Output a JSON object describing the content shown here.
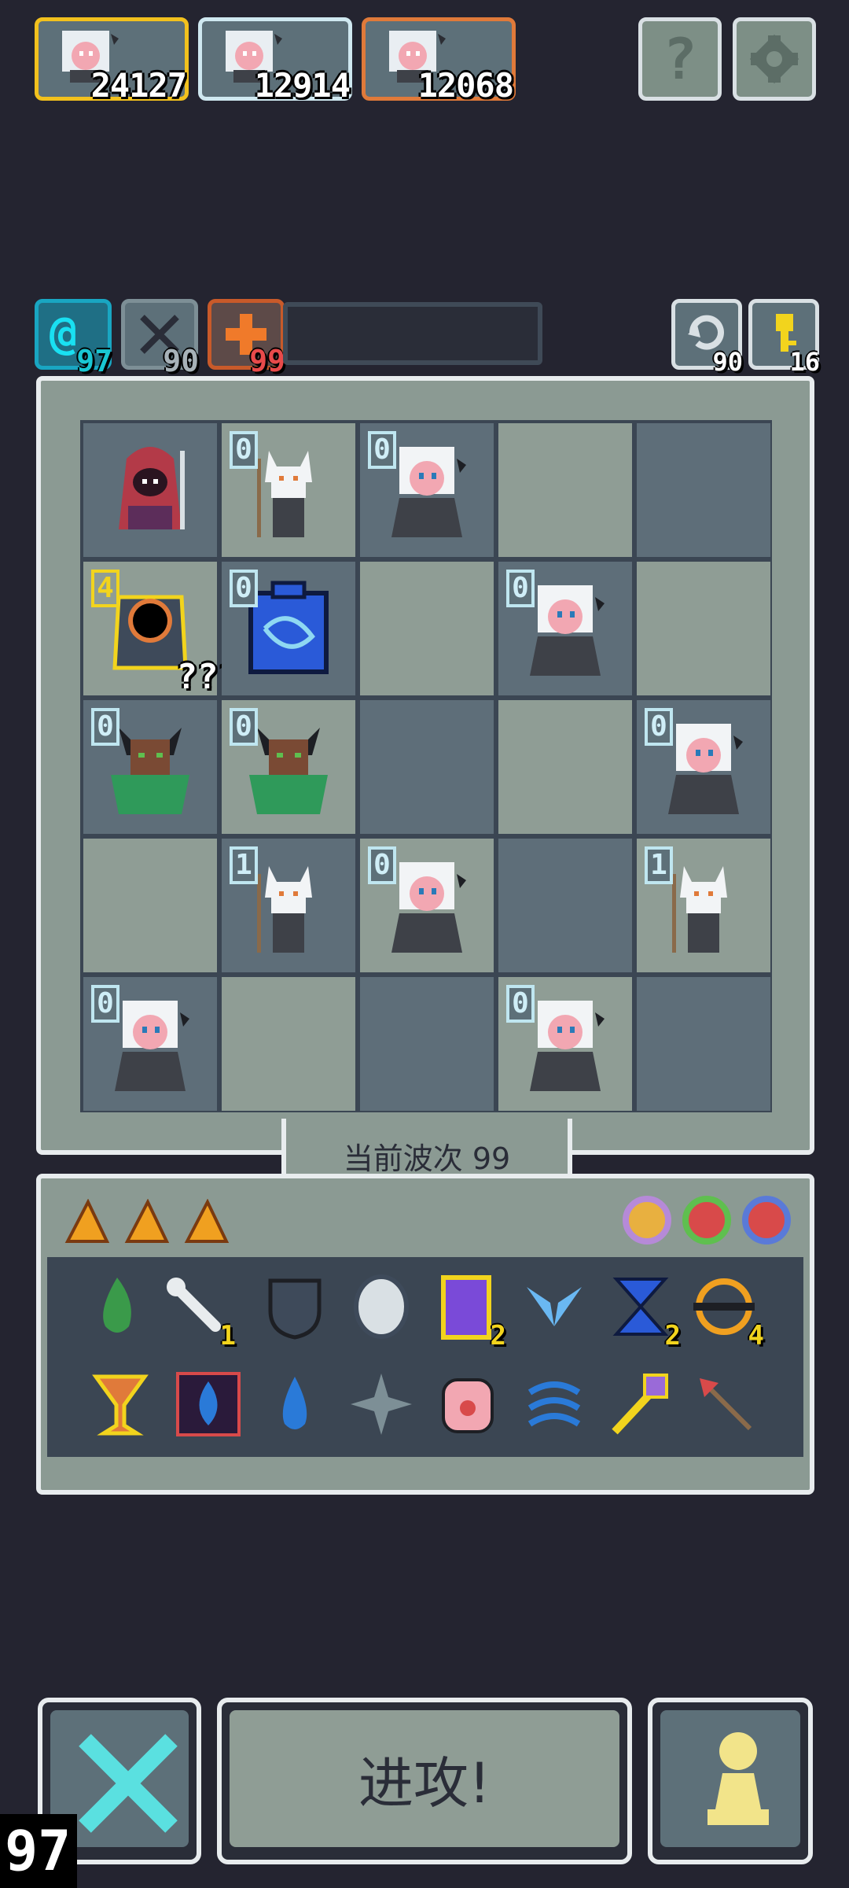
{
  "heroes": [
    {
      "score": "24127",
      "frame": "gold"
    },
    {
      "score": "12914",
      "frame": "silver"
    },
    {
      "score": "12068",
      "frame": "bronze"
    }
  ],
  "top_buttons": {
    "help_icon": "question-icon",
    "settings_icon": "gear-icon"
  },
  "stats": [
    {
      "icon": "spiral-icon",
      "value": "97",
      "color": "#19c6d2"
    },
    {
      "icon": "sword-icon",
      "value": "90",
      "color": "#a7b2b8"
    },
    {
      "icon": "cross-icon",
      "value": "99",
      "color": "#e84a4a"
    }
  ],
  "corner": {
    "refresh_value": "90",
    "key_value": "16"
  },
  "board": {
    "wave_label": "当前波次 99",
    "cells": [
      {
        "unit": "hooded-mage",
        "level": ""
      },
      {
        "unit": "fox-shaman",
        "level": "0"
      },
      {
        "unit": "ghost-girl",
        "level": "0"
      },
      {
        "unit": "",
        "level": ""
      },
      {
        "unit": "",
        "level": ""
      },
      {
        "unit": "void-eye",
        "level": "4",
        "special": "???"
      },
      {
        "unit": "blue-cube",
        "level": "0"
      },
      {
        "unit": "",
        "level": ""
      },
      {
        "unit": "ghost-girl",
        "level": "0"
      },
      {
        "unit": "",
        "level": ""
      },
      {
        "unit": "horned-druid",
        "level": "0"
      },
      {
        "unit": "horned-druid",
        "level": "0"
      },
      {
        "unit": "",
        "level": ""
      },
      {
        "unit": "",
        "level": ""
      },
      {
        "unit": "ghost-girl",
        "level": "0"
      },
      {
        "unit": "",
        "level": ""
      },
      {
        "unit": "fox-shaman",
        "level": "1"
      },
      {
        "unit": "ghost-girl",
        "level": "0"
      },
      {
        "unit": "",
        "level": ""
      },
      {
        "unit": "fox-shaman",
        "level": "1"
      },
      {
        "unit": "ghost-girl",
        "level": "0"
      },
      {
        "unit": "",
        "level": ""
      },
      {
        "unit": "",
        "level": ""
      },
      {
        "unit": "ghost-girl",
        "level": "0"
      },
      {
        "unit": "",
        "level": ""
      }
    ]
  },
  "inventory": {
    "shards": [
      "shard-icon",
      "shard-icon",
      "shard-icon"
    ],
    "orbs": [
      {
        "icon": "purple-orb-icon",
        "color": "#b68ad8"
      },
      {
        "icon": "green-orb-icon",
        "color": "#5fbf4f"
      },
      {
        "icon": "blue-orb-icon",
        "color": "#5a7ad8"
      }
    ],
    "row1": [
      {
        "icon": "green-flame-icon",
        "count": ""
      },
      {
        "icon": "bone-icon",
        "count": "1"
      },
      {
        "icon": "shield-icon",
        "count": ""
      },
      {
        "icon": "mirror-icon",
        "count": ""
      },
      {
        "icon": "potion-jar-icon",
        "count": "2"
      },
      {
        "icon": "blue-wings-icon",
        "count": ""
      },
      {
        "icon": "hourglass-icon",
        "count": "2"
      },
      {
        "icon": "ring-orb-icon",
        "count": "4"
      }
    ],
    "row2": [
      {
        "icon": "chalice-icon",
        "count": ""
      },
      {
        "icon": "water-tome-icon",
        "count": ""
      },
      {
        "icon": "water-drop-icon",
        "count": ""
      },
      {
        "icon": "shuriken-icon",
        "count": ""
      },
      {
        "icon": "eye-hand-icon",
        "count": ""
      },
      {
        "icon": "wave-icon",
        "count": ""
      },
      {
        "icon": "staff-icon",
        "count": ""
      },
      {
        "icon": "arrow-icon",
        "count": ""
      }
    ]
  },
  "actions": {
    "attack_label": "进攻!",
    "cancel_icon": "crossed-swords-icon",
    "pawn_icon": "pawn-icon"
  },
  "fps": "97"
}
